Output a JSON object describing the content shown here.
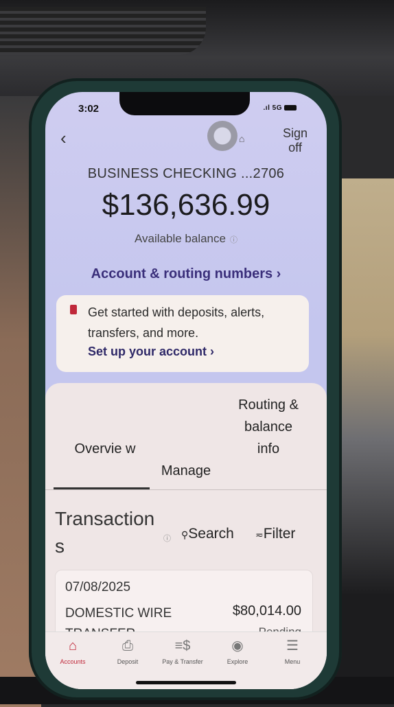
{
  "status_bar": {
    "time": "3:02",
    "network": "5G"
  },
  "header": {
    "signoff_line1": "Sign",
    "signoff_line2": "off"
  },
  "account": {
    "title": "BUSINESS CHECKING ...2706",
    "balance": "$136,636.99",
    "balance_label": "Available balance",
    "routing_link": "Account & routing numbers ›"
  },
  "promo": {
    "text": "Get started with deposits, alerts, transfers, and more.",
    "link": "Set up your account ›"
  },
  "tabs": {
    "overview": "Overvie w",
    "manage": "Manage",
    "routing": "Routing & balance info"
  },
  "transactions": {
    "heading": "Transactions",
    "search": "Search",
    "filter": "Filter",
    "items": [
      {
        "date": "07/08/2025",
        "description": "DOMESTIC WIRE TRANSFER",
        "amount": "$80,014.00",
        "status": "Pending"
      }
    ]
  },
  "bottom_nav": {
    "items": [
      {
        "label": "Accounts",
        "icon": "home-icon"
      },
      {
        "label": "Deposit",
        "icon": "deposit-icon"
      },
      {
        "label": "Pay & Transfer",
        "icon": "dollar-icon"
      },
      {
        "label": "Explore",
        "icon": "compass-icon"
      },
      {
        "label": "Menu",
        "icon": "menu-icon"
      }
    ]
  }
}
